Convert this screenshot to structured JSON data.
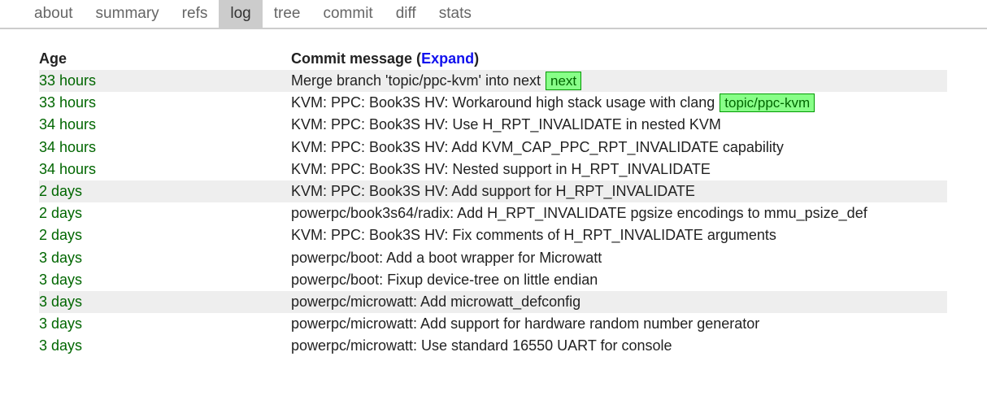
{
  "tabs": [
    {
      "label": "about",
      "active": false
    },
    {
      "label": "summary",
      "active": false
    },
    {
      "label": "refs",
      "active": false
    },
    {
      "label": "log",
      "active": true
    },
    {
      "label": "tree",
      "active": false
    },
    {
      "label": "commit",
      "active": false
    },
    {
      "label": "diff",
      "active": false
    },
    {
      "label": "stats",
      "active": false
    }
  ],
  "header": {
    "age_label": "Age",
    "msg_label_prefix": "Commit message (",
    "expand_label": "Expand",
    "msg_label_suffix": ")"
  },
  "commits": [
    {
      "age": "33 hours",
      "msg": "Merge branch 'topic/ppc-kvm' into next",
      "tag": "next"
    },
    {
      "age": "33 hours",
      "msg": "KVM: PPC: Book3S HV: Workaround high stack usage with clang",
      "tag": "topic/ppc-kvm"
    },
    {
      "age": "34 hours",
      "msg": "KVM: PPC: Book3S HV: Use H_RPT_INVALIDATE in nested KVM"
    },
    {
      "age": "34 hours",
      "msg": "KVM: PPC: Book3S HV: Add KVM_CAP_PPC_RPT_INVALIDATE capability"
    },
    {
      "age": "34 hours",
      "msg": "KVM: PPC: Book3S HV: Nested support in H_RPT_INVALIDATE"
    },
    {
      "age": "2 days",
      "msg": "KVM: PPC: Book3S HV: Add support for H_RPT_INVALIDATE"
    },
    {
      "age": "2 days",
      "msg": "powerpc/book3s64/radix: Add H_RPT_INVALIDATE pgsize encodings to mmu_psize_def"
    },
    {
      "age": "2 days",
      "msg": "KVM: PPC: Book3S HV: Fix comments of H_RPT_INVALIDATE arguments"
    },
    {
      "age": "3 days",
      "msg": "powerpc/boot: Add a boot wrapper for Microwatt"
    },
    {
      "age": "3 days",
      "msg": "powerpc/boot: Fixup device-tree on little endian"
    },
    {
      "age": "3 days",
      "msg": "powerpc/microwatt: Add microwatt_defconfig"
    },
    {
      "age": "3 days",
      "msg": "powerpc/microwatt: Add support for hardware random number generator"
    },
    {
      "age": "3 days",
      "msg": "powerpc/microwatt: Use standard 16550 UART for console"
    }
  ],
  "shaded_indices": [
    0,
    5,
    10
  ]
}
